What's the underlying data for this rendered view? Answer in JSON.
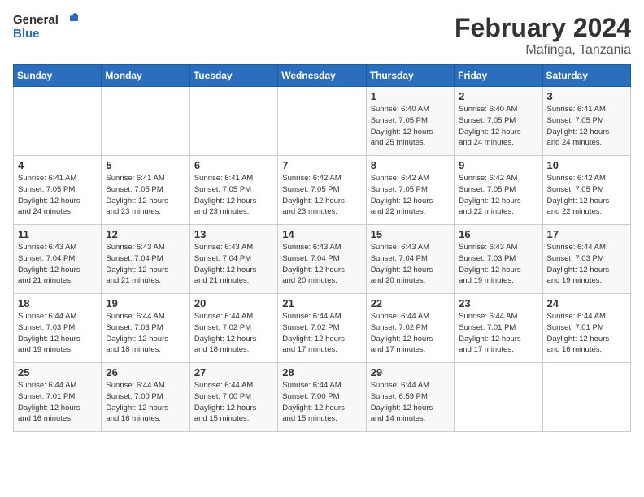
{
  "logo": {
    "line1": "General",
    "line2": "Blue"
  },
  "title": "February 2024",
  "subtitle": "Mafinga, Tanzania",
  "days_header": [
    "Sunday",
    "Monday",
    "Tuesday",
    "Wednesday",
    "Thursday",
    "Friday",
    "Saturday"
  ],
  "weeks": [
    [
      {
        "num": "",
        "info": ""
      },
      {
        "num": "",
        "info": ""
      },
      {
        "num": "",
        "info": ""
      },
      {
        "num": "",
        "info": ""
      },
      {
        "num": "1",
        "info": "Sunrise: 6:40 AM\nSunset: 7:05 PM\nDaylight: 12 hours\nand 25 minutes."
      },
      {
        "num": "2",
        "info": "Sunrise: 6:40 AM\nSunset: 7:05 PM\nDaylight: 12 hours\nand 24 minutes."
      },
      {
        "num": "3",
        "info": "Sunrise: 6:41 AM\nSunset: 7:05 PM\nDaylight: 12 hours\nand 24 minutes."
      }
    ],
    [
      {
        "num": "4",
        "info": "Sunrise: 6:41 AM\nSunset: 7:05 PM\nDaylight: 12 hours\nand 24 minutes."
      },
      {
        "num": "5",
        "info": "Sunrise: 6:41 AM\nSunset: 7:05 PM\nDaylight: 12 hours\nand 23 minutes."
      },
      {
        "num": "6",
        "info": "Sunrise: 6:41 AM\nSunset: 7:05 PM\nDaylight: 12 hours\nand 23 minutes."
      },
      {
        "num": "7",
        "info": "Sunrise: 6:42 AM\nSunset: 7:05 PM\nDaylight: 12 hours\nand 23 minutes."
      },
      {
        "num": "8",
        "info": "Sunrise: 6:42 AM\nSunset: 7:05 PM\nDaylight: 12 hours\nand 22 minutes."
      },
      {
        "num": "9",
        "info": "Sunrise: 6:42 AM\nSunset: 7:05 PM\nDaylight: 12 hours\nand 22 minutes."
      },
      {
        "num": "10",
        "info": "Sunrise: 6:42 AM\nSunset: 7:05 PM\nDaylight: 12 hours\nand 22 minutes."
      }
    ],
    [
      {
        "num": "11",
        "info": "Sunrise: 6:43 AM\nSunset: 7:04 PM\nDaylight: 12 hours\nand 21 minutes."
      },
      {
        "num": "12",
        "info": "Sunrise: 6:43 AM\nSunset: 7:04 PM\nDaylight: 12 hours\nand 21 minutes."
      },
      {
        "num": "13",
        "info": "Sunrise: 6:43 AM\nSunset: 7:04 PM\nDaylight: 12 hours\nand 21 minutes."
      },
      {
        "num": "14",
        "info": "Sunrise: 6:43 AM\nSunset: 7:04 PM\nDaylight: 12 hours\nand 20 minutes."
      },
      {
        "num": "15",
        "info": "Sunrise: 6:43 AM\nSunset: 7:04 PM\nDaylight: 12 hours\nand 20 minutes."
      },
      {
        "num": "16",
        "info": "Sunrise: 6:43 AM\nSunset: 7:03 PM\nDaylight: 12 hours\nand 19 minutes."
      },
      {
        "num": "17",
        "info": "Sunrise: 6:44 AM\nSunset: 7:03 PM\nDaylight: 12 hours\nand 19 minutes."
      }
    ],
    [
      {
        "num": "18",
        "info": "Sunrise: 6:44 AM\nSunset: 7:03 PM\nDaylight: 12 hours\nand 19 minutes."
      },
      {
        "num": "19",
        "info": "Sunrise: 6:44 AM\nSunset: 7:03 PM\nDaylight: 12 hours\nand 18 minutes."
      },
      {
        "num": "20",
        "info": "Sunrise: 6:44 AM\nSunset: 7:02 PM\nDaylight: 12 hours\nand 18 minutes."
      },
      {
        "num": "21",
        "info": "Sunrise: 6:44 AM\nSunset: 7:02 PM\nDaylight: 12 hours\nand 17 minutes."
      },
      {
        "num": "22",
        "info": "Sunrise: 6:44 AM\nSunset: 7:02 PM\nDaylight: 12 hours\nand 17 minutes."
      },
      {
        "num": "23",
        "info": "Sunrise: 6:44 AM\nSunset: 7:01 PM\nDaylight: 12 hours\nand 17 minutes."
      },
      {
        "num": "24",
        "info": "Sunrise: 6:44 AM\nSunset: 7:01 PM\nDaylight: 12 hours\nand 16 minutes."
      }
    ],
    [
      {
        "num": "25",
        "info": "Sunrise: 6:44 AM\nSunset: 7:01 PM\nDaylight: 12 hours\nand 16 minutes."
      },
      {
        "num": "26",
        "info": "Sunrise: 6:44 AM\nSunset: 7:00 PM\nDaylight: 12 hours\nand 16 minutes."
      },
      {
        "num": "27",
        "info": "Sunrise: 6:44 AM\nSunset: 7:00 PM\nDaylight: 12 hours\nand 15 minutes."
      },
      {
        "num": "28",
        "info": "Sunrise: 6:44 AM\nSunset: 7:00 PM\nDaylight: 12 hours\nand 15 minutes."
      },
      {
        "num": "29",
        "info": "Sunrise: 6:44 AM\nSunset: 6:59 PM\nDaylight: 12 hours\nand 14 minutes."
      },
      {
        "num": "",
        "info": ""
      },
      {
        "num": "",
        "info": ""
      }
    ]
  ]
}
